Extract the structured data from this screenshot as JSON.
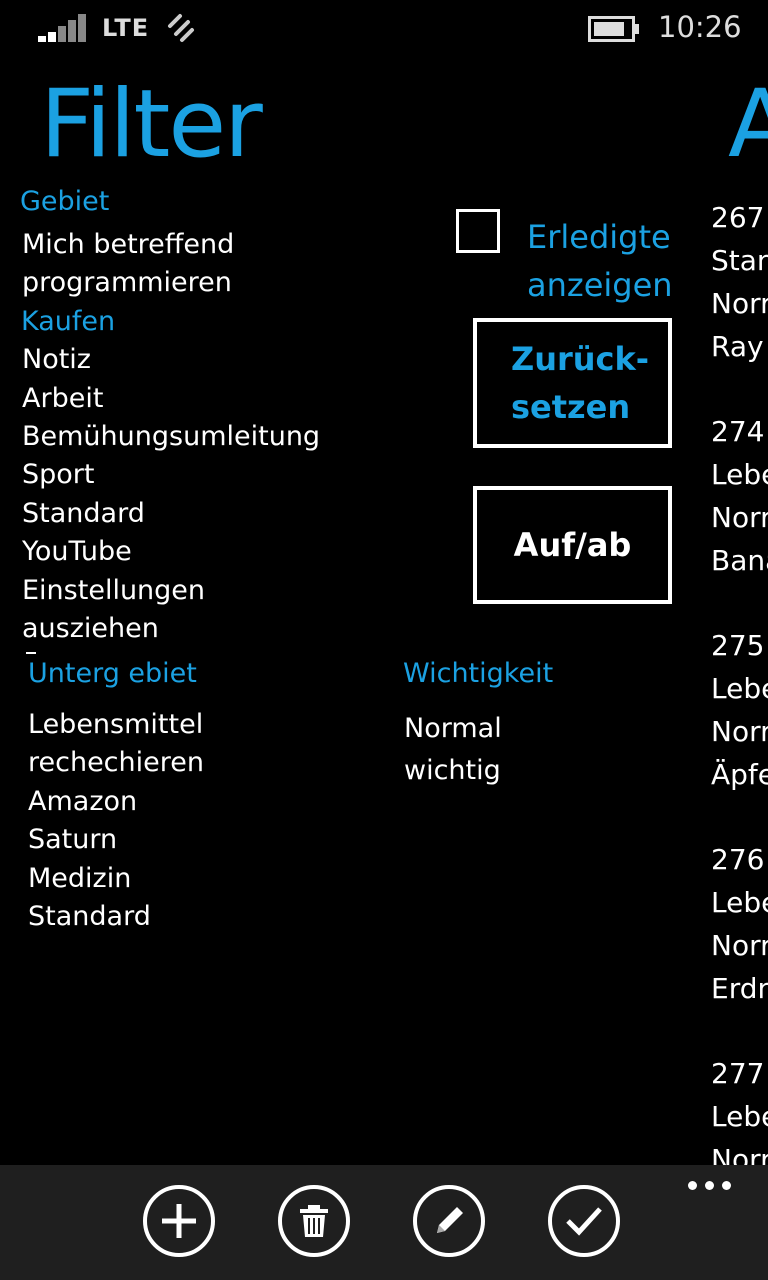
{
  "status": {
    "network": "LTE",
    "time": "10:26"
  },
  "page": {
    "title": "Filter",
    "next_title_fragment": "A"
  },
  "gebiet": {
    "heading": "Gebiet",
    "items": [
      {
        "label": "Mich betreffend",
        "color": "#ffffff"
      },
      {
        "label": "programmieren",
        "color": "#ffffff"
      },
      {
        "label": "Kaufen",
        "color": "#1ba1e2"
      },
      {
        "label": "Notiz",
        "color": "#ffffff"
      },
      {
        "label": "Arbeit",
        "color": "#ffffff"
      },
      {
        "label": "Bemühungsumleitung",
        "color": "#ffffff"
      },
      {
        "label": "Sport",
        "color": "#ffffff"
      },
      {
        "label": "Standard",
        "color": "#ffffff"
      },
      {
        "label": "YouTube",
        "color": "#ffffff"
      },
      {
        "label": "Einstellungen",
        "color": "#ffffff"
      },
      {
        "label": "ausziehen",
        "color": "#ffffff"
      }
    ]
  },
  "untergebiet": {
    "heading": "Unterg ebiet",
    "items": [
      "Lebensmittel",
      "rechechieren",
      "Amazon",
      "Saturn",
      "Medizin",
      "Standard"
    ]
  },
  "wichtigkeit": {
    "heading": "Wichtigkeit",
    "items": [
      "Normal",
      "wichtig"
    ]
  },
  "controls": {
    "checkbox_label_line1": "Erledigte",
    "checkbox_label_line2": "anzeigen",
    "checked": false,
    "reset_line1": "Zurück-",
    "reset_line2": "setzen",
    "sort_label": "Auf/ab"
  },
  "tasks": [
    {
      "id": "267",
      "lines": [
        "Stan",
        "Norr",
        "Ray"
      ]
    },
    {
      "id": "274",
      "lines": [
        "Lebe",
        "Norr",
        "Bana"
      ]
    },
    {
      "id": "275",
      "lines": [
        "Lebe",
        "Norr",
        "Äpfe"
      ]
    },
    {
      "id": "276",
      "lines": [
        "Lebe",
        "Norr",
        "Erdn"
      ]
    },
    {
      "id": "277",
      "lines": [
        "Lebe",
        "Norr"
      ]
    }
  ],
  "appbar": {
    "buttons": [
      {
        "name": "add",
        "icon": "plus-icon"
      },
      {
        "name": "delete",
        "icon": "trash-icon"
      },
      {
        "name": "edit",
        "icon": "pencil-icon"
      },
      {
        "name": "done",
        "icon": "check-icon"
      }
    ],
    "more_icon": "ellipsis-icon"
  },
  "colors": {
    "accent": "#1ba1e2",
    "background": "#000000",
    "appbar": "#1f1f1f"
  }
}
